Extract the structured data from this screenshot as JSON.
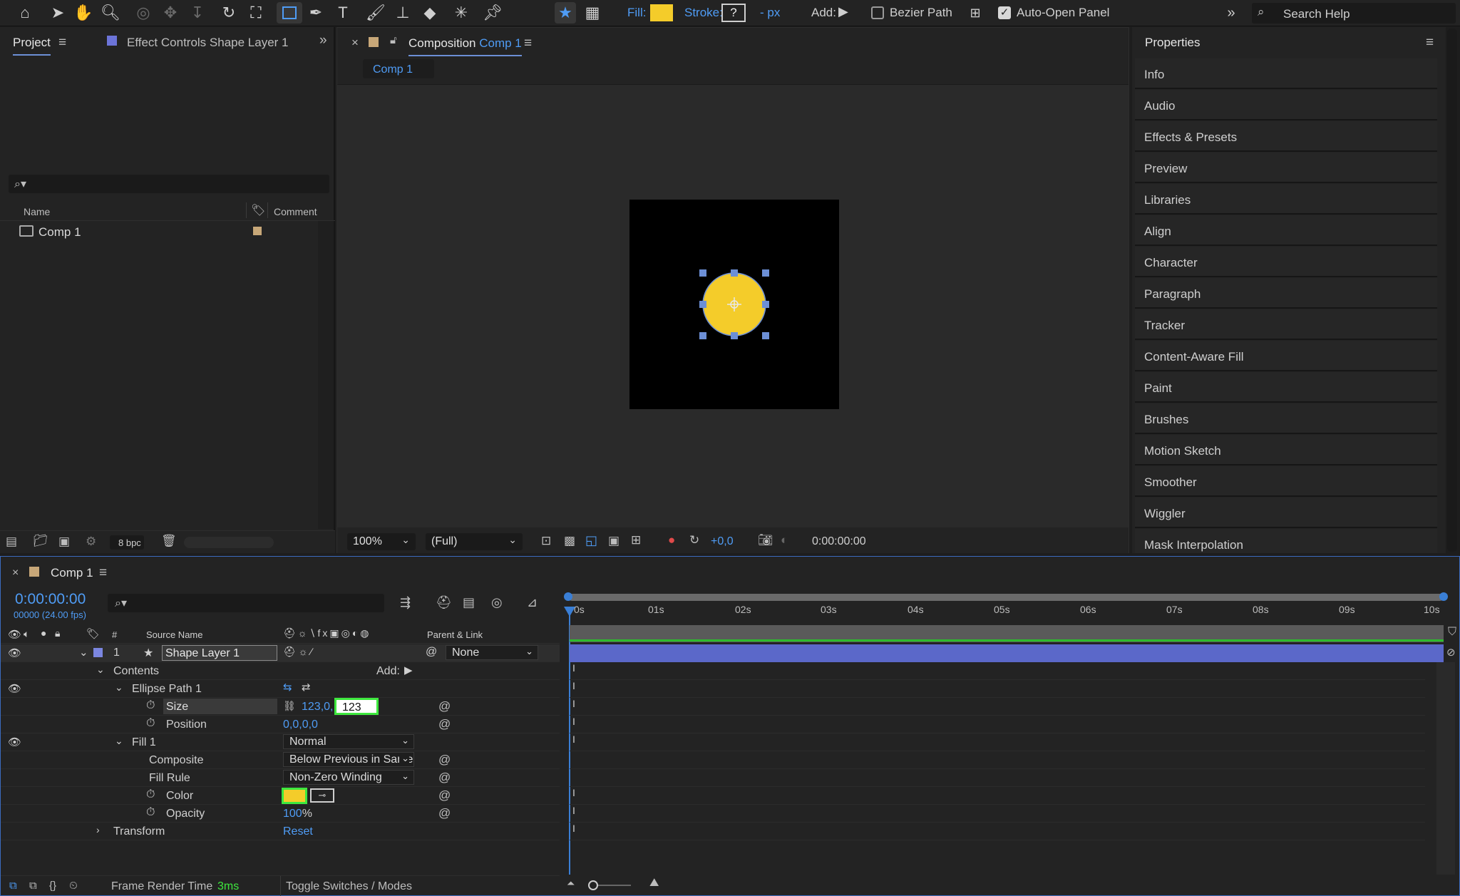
{
  "toolbar": {
    "fill_label": "Fill:",
    "stroke_label": "Stroke:",
    "stroke_value": "?",
    "stroke_unit": "- px",
    "add_label": "Add:",
    "bezier_path_label": "Bezier Path",
    "auto_open_panel_label": "Auto-Open Panel",
    "search_placeholder": "Search Help",
    "fill_color": "#f4cc2a"
  },
  "project_panel": {
    "tab_project": "Project",
    "tab_effect_controls": "Effect Controls Shape Layer 1",
    "col_name": "Name",
    "col_comment": "Comment",
    "item_name": "Comp 1",
    "bpc": "8 bpc"
  },
  "composition_panel": {
    "tab_label": "Composition",
    "tab_comp_name": "Comp 1",
    "subtab": "Comp 1",
    "zoom": "100%",
    "resolution": "(Full)",
    "exposure": "+0,0",
    "timecode": "0:00:00:00"
  },
  "properties_panel": {
    "title": "Properties",
    "items": [
      "Info",
      "Audio",
      "Effects & Presets",
      "Preview",
      "Libraries",
      "Align",
      "Character",
      "Paragraph",
      "Tracker",
      "Content-Aware Fill",
      "Paint",
      "Brushes",
      "Motion Sketch",
      "Smoother",
      "Wiggler",
      "Mask Interpolation"
    ]
  },
  "timeline": {
    "tab": "Comp 1",
    "timecode": "0:00:00:00",
    "frames": "00000 (24.00 fps)",
    "col_number": "#",
    "col_source_name": "Source Name",
    "col_parent": "Parent & Link",
    "layer_number": "1",
    "layer_name": "Shape Layer 1",
    "parent_value": "None",
    "contents": "Contents",
    "add_label": "Add:",
    "ellipse_path": "Ellipse Path 1",
    "size_label": "Size",
    "size_value_a": "123,0,",
    "size_value_b": "123",
    "position_label": "Position",
    "position_value": "0,0,0,0",
    "fill_group": "Fill 1",
    "blend_mode": "Normal",
    "composite_label": "Composite",
    "composite_value": "Below Previous in Same Group",
    "fill_rule_label": "Fill Rule",
    "fill_rule_value": "Non-Zero Winding",
    "color_label": "Color",
    "opacity_label": "Opacity",
    "opacity_value": "100",
    "opacity_unit": "%",
    "transform_label": "Transform",
    "transform_reset": "Reset",
    "frame_render_label": "Frame Render Time",
    "frame_render_value": "3ms",
    "toggle_label": "Toggle Switches / Modes",
    "ruler_labels": [
      "0s",
      "01s",
      "02s",
      "03s",
      "04s",
      "05s",
      "06s",
      "07s",
      "08s",
      "09s",
      "10s"
    ]
  }
}
